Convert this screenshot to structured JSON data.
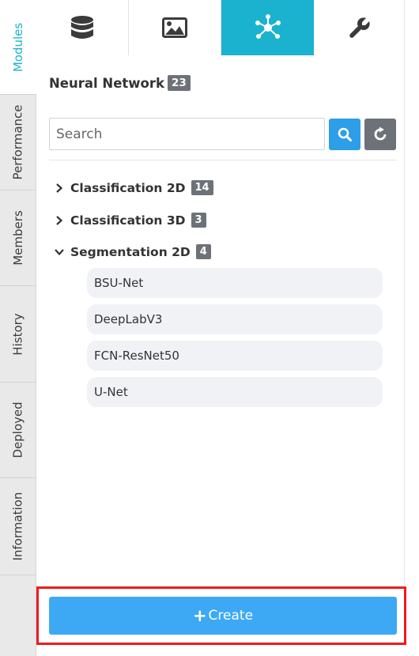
{
  "side_tabs": [
    {
      "label": "Modules",
      "active": true
    },
    {
      "label": "Performance",
      "active": false
    },
    {
      "label": "Members",
      "active": false
    },
    {
      "label": "History",
      "active": false
    },
    {
      "label": "Deployed",
      "active": false
    },
    {
      "label": "Information",
      "active": false
    }
  ],
  "top_tabs": [
    {
      "icon": "database-icon",
      "active": false
    },
    {
      "icon": "image-icon",
      "active": false
    },
    {
      "icon": "network-icon",
      "active": true
    },
    {
      "icon": "wrench-icon",
      "active": false
    }
  ],
  "header": {
    "title": "Neural Network",
    "count": "23"
  },
  "search": {
    "placeholder": "Search",
    "value": ""
  },
  "tree": {
    "groups": [
      {
        "label": "Classification 2D",
        "count": "14",
        "expanded": false
      },
      {
        "label": "Classification 3D",
        "count": "3",
        "expanded": false
      },
      {
        "label": "Segmentation 2D",
        "count": "4",
        "expanded": true,
        "items": [
          "BSU-Net",
          "DeepLabV3",
          "FCN-ResNet50",
          "U-Net"
        ]
      }
    ]
  },
  "footer": {
    "create_label": "Create"
  },
  "colors": {
    "accent": "#1ab2cf",
    "primary_button": "#3da9f5",
    "badge": "#6d7178",
    "highlight": "#ee1c1c"
  }
}
